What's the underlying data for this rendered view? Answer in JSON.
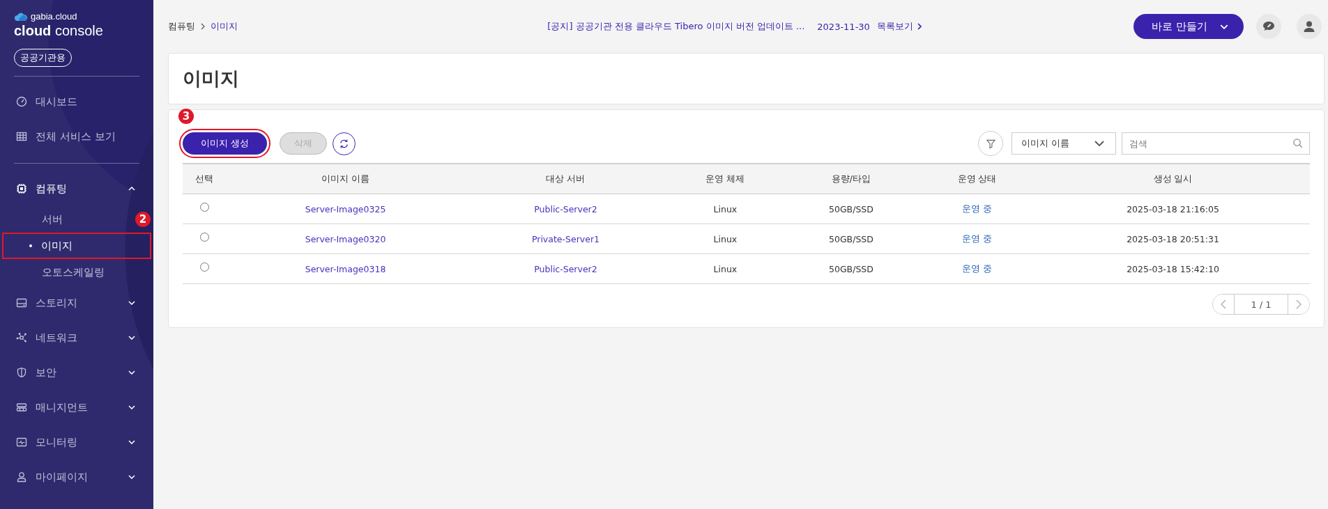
{
  "sidebar": {
    "brand": "gabia.cloud",
    "title_bold": "cloud",
    "title_light": "console",
    "badge": "공공기관용",
    "top_items": [
      {
        "label": "대시보드"
      },
      {
        "label": "전체 서비스 보기"
      }
    ],
    "menu": [
      {
        "label": "컴퓨팅",
        "expanded": true,
        "children": [
          {
            "label": "서버",
            "selected": false,
            "highlighted": false
          },
          {
            "label": "이미지",
            "selected": true,
            "highlighted": true,
            "step": "2"
          },
          {
            "label": "오토스케일링",
            "selected": false,
            "highlighted": false
          }
        ]
      },
      {
        "label": "스토리지",
        "expanded": false
      },
      {
        "label": "네트워크",
        "expanded": false
      },
      {
        "label": "보안",
        "expanded": false
      },
      {
        "label": "매니지먼트",
        "expanded": false
      },
      {
        "label": "모니터링",
        "expanded": false
      },
      {
        "label": "마이페이지",
        "expanded": false
      }
    ]
  },
  "header": {
    "breadcrumb": [
      "컴퓨팅",
      "이미지"
    ],
    "notice": {
      "text": "[공지] 공공기관 전용 클라우드 Tibero 이미지 버전 업데이트 ...",
      "date": "2023-11-30",
      "link": "목록보기"
    },
    "quick_button": "바로 만들기"
  },
  "page_title": "이미지",
  "toolbar": {
    "create_button": {
      "label": "이미지 생성",
      "highlighted": true,
      "step": "3"
    },
    "delete_button": {
      "label": "삭제",
      "disabled": true
    },
    "filter_select": "이미지 이름",
    "search": {
      "placeholder": "검색"
    }
  },
  "table": {
    "columns": [
      "선택",
      "이미지 이름",
      "대상 서버",
      "운영 체제",
      "용량/타입",
      "운영 상태",
      "생성 일시"
    ],
    "rows": [
      {
        "selected": false,
        "name": "Server-Image0325",
        "server": "Public-Server2",
        "os": "Linux",
        "size": "50GB/SSD",
        "status": "운영 중",
        "created": "2025-03-18 21:16:05"
      },
      {
        "selected": false,
        "name": "Server-Image0320",
        "server": "Private-Server1",
        "os": "Linux",
        "size": "50GB/SSD",
        "status": "운영 중",
        "created": "2025-03-18 20:51:31"
      },
      {
        "selected": false,
        "name": "Server-Image0318",
        "server": "Public-Server2",
        "os": "Linux",
        "size": "50GB/SSD",
        "status": "운영 중",
        "created": "2025-03-18 15:42:10"
      }
    ]
  },
  "pagination": "1 / 1"
}
